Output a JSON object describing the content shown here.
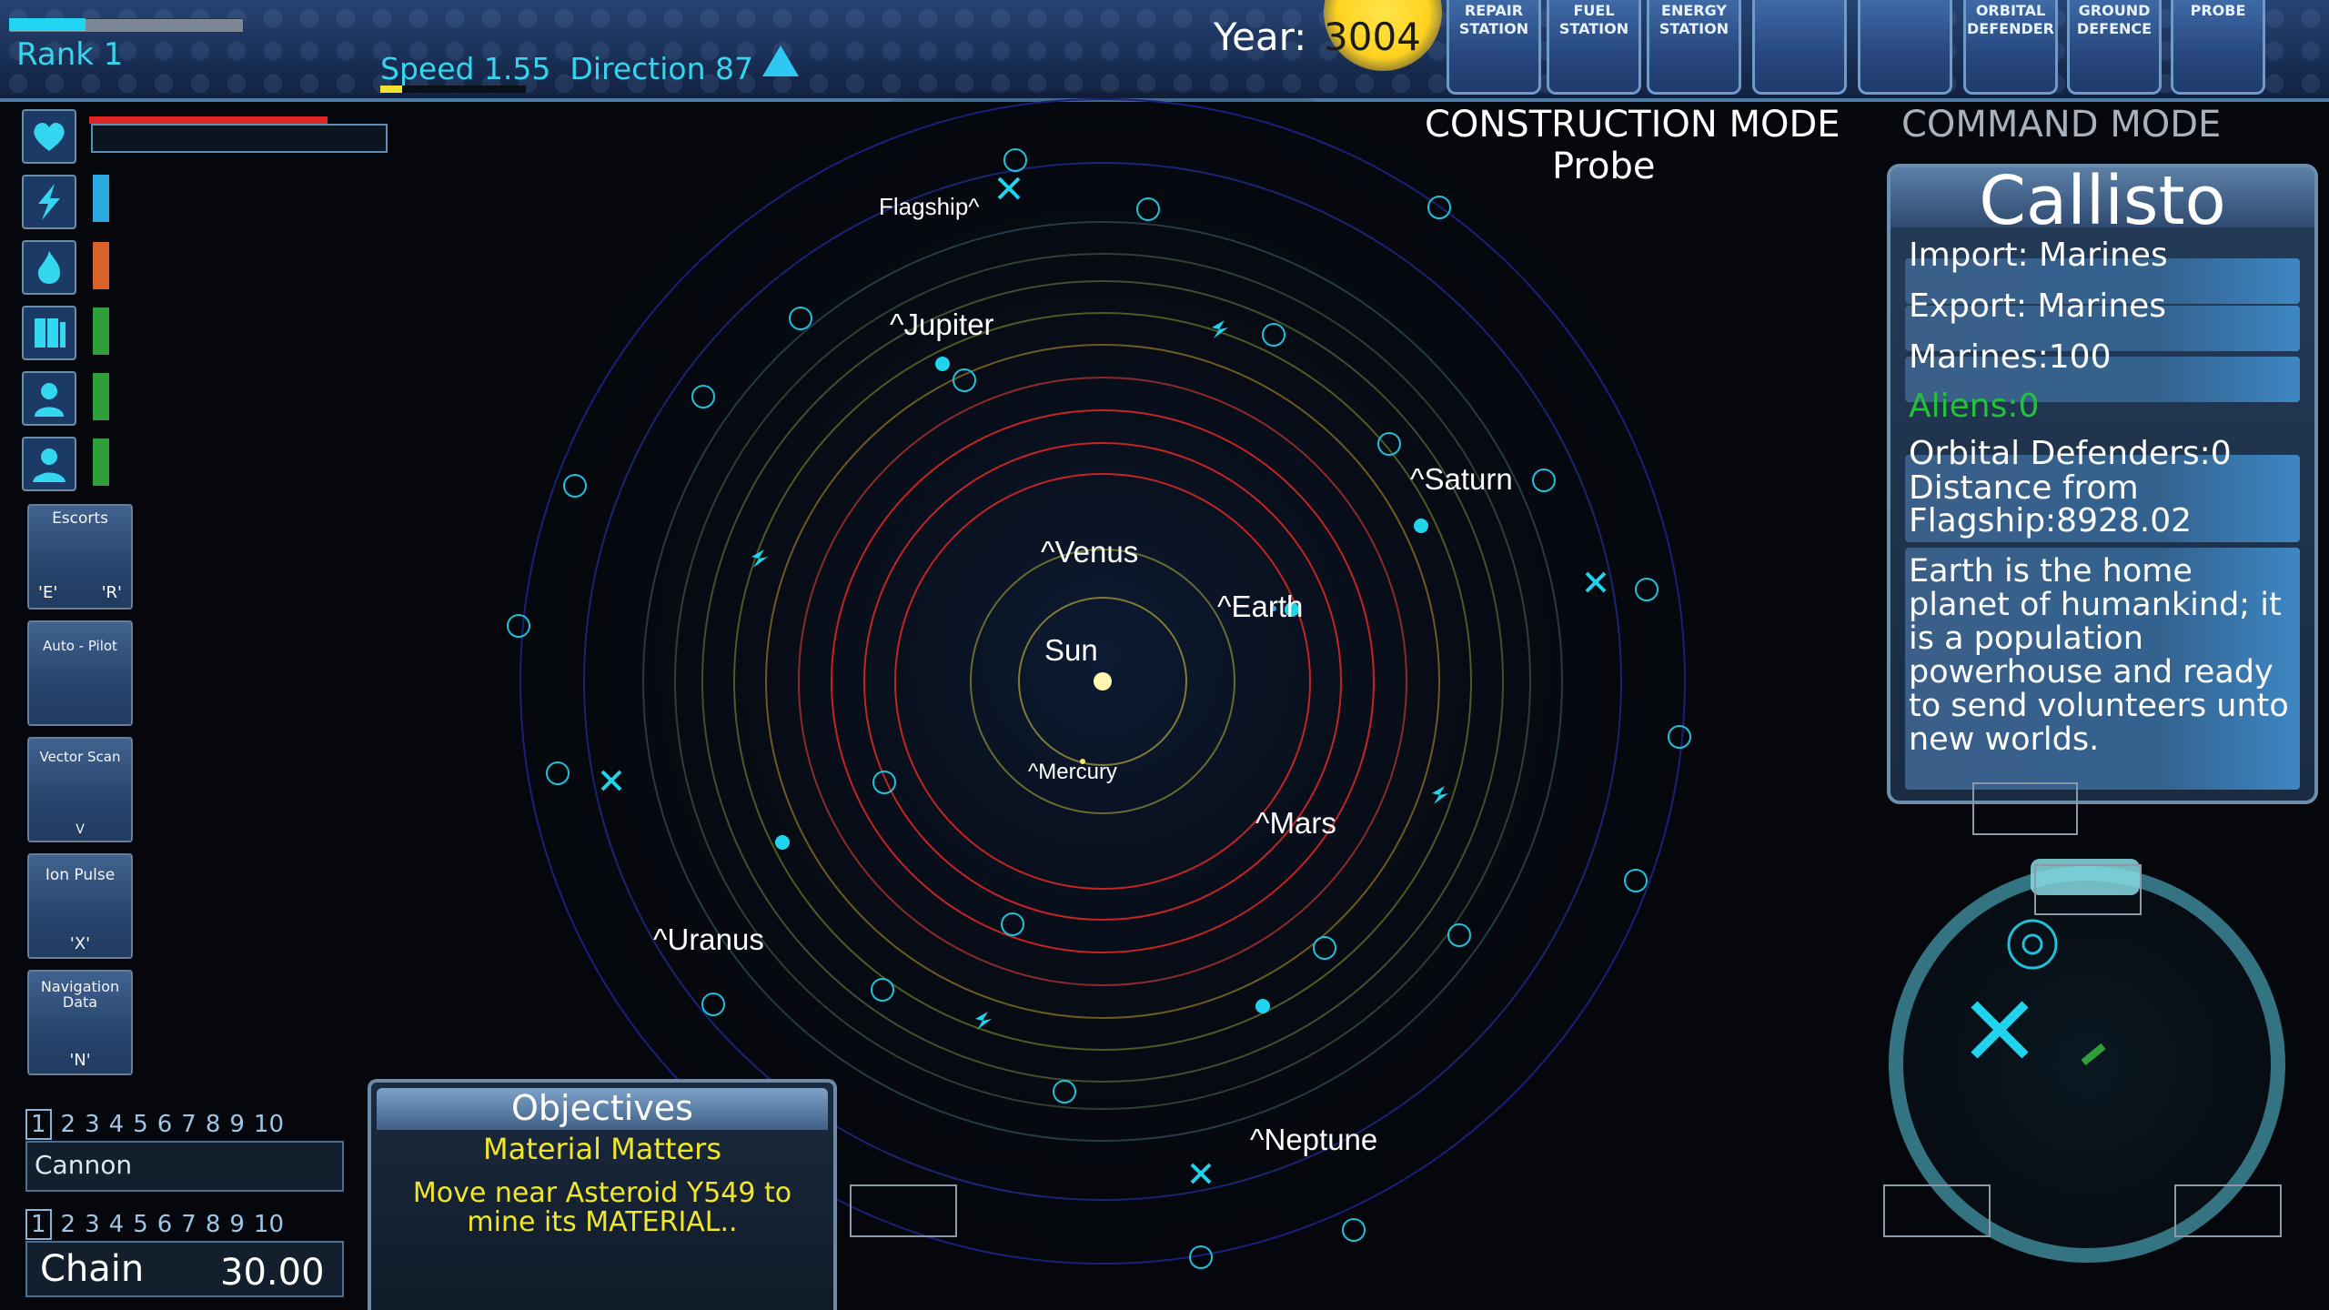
{
  "hud": {
    "rank": "Rank 1",
    "rank_progress": 0.33,
    "speed": "Speed 1.55",
    "direction": "Direction 87",
    "speed_fill": 0.15,
    "year_label": "Year:",
    "year_value": "3004"
  },
  "build_menu": [
    {
      "label_1": "REPAIR",
      "label_2": "STATION"
    },
    {
      "label_1": "FUEL",
      "label_2": "STATION"
    },
    {
      "label_1": "ENERGY",
      "label_2": "STATION"
    },
    {
      "label_1": "",
      "label_2": ""
    },
    {
      "label_1": "",
      "label_2": ""
    },
    {
      "label_1": "ORBITAL",
      "label_2": "DEFENDER"
    },
    {
      "label_1": "GROUND",
      "label_2": "DEFENCE"
    },
    {
      "label_1": "PROBE",
      "label_2": ""
    }
  ],
  "modes": {
    "construction": "CONSTRUCTION MODE",
    "construction_item": "Probe",
    "command": "COMMAND MODE"
  },
  "status_icons": [
    {
      "icon": "heart-icon",
      "level": 0.85,
      "color": "#e02424"
    },
    {
      "icon": "energy-bolt-icon",
      "level": 0.5,
      "color": "#2aa8e0"
    },
    {
      "icon": "fuel-flame-icon",
      "level": 0.45,
      "color": "#d9622a"
    },
    {
      "icon": "cargo-icon",
      "level": 0.55,
      "color": "#2ea03a"
    },
    {
      "icon": "crew-icon",
      "level": 0.55,
      "color": "#2ea03a"
    },
    {
      "icon": "marine-icon",
      "level": 0.55,
      "color": "#2ea03a"
    }
  ],
  "abilities": {
    "escorts": {
      "title": "Escorts",
      "key_e": "'E'",
      "key_r": "'R'"
    },
    "autopilot": {
      "title": "Auto - Pilot"
    },
    "vector_scan": {
      "title": "Vector Scan",
      "key": "V"
    },
    "ion_pulse": {
      "title": "Ion Pulse",
      "key": "'X'"
    },
    "nav_data": {
      "title": "Navigation Data",
      "key": "'N'"
    }
  },
  "weapons": {
    "slots": [
      "1",
      "2",
      "3",
      "4",
      "5",
      "6",
      "7",
      "8",
      "9",
      "10"
    ],
    "primary": "Cannon",
    "secondary": "Chain",
    "secondary_value": "30.00"
  },
  "objectives": {
    "header": "Objectives",
    "title": "Material Matters",
    "text": "Move near Asteroid Y549 to mine its MATERIAL.."
  },
  "planet_info": {
    "name": "Callisto",
    "import": "Import: Marines",
    "export": "Export: Marines",
    "marines": "Marines:100",
    "aliens": "Aliens:0",
    "orbital_defenders": "Orbital Defenders:0",
    "distance_line1": "Distance from",
    "distance_line2": "Flagship:8928.02",
    "description": "Earth is the home planet of humankind; it is a population powerhouse and ready to send volunteers unto new worlds."
  },
  "map_labels": {
    "flagship": "Flagship^",
    "jupiter": "^Jupiter",
    "saturn": "^Saturn",
    "venus": "^Venus",
    "earth": "^Earth",
    "sun": "Sun",
    "mercury": "^Mercury",
    "mars": "^Mars",
    "uranus": "^Uranus",
    "neptune": "^Neptune"
  },
  "colors": {
    "accent": "#32d6ee",
    "panel": "#243b58",
    "objective_text": "#f0e62a",
    "aliens_text": "#23c23a"
  }
}
